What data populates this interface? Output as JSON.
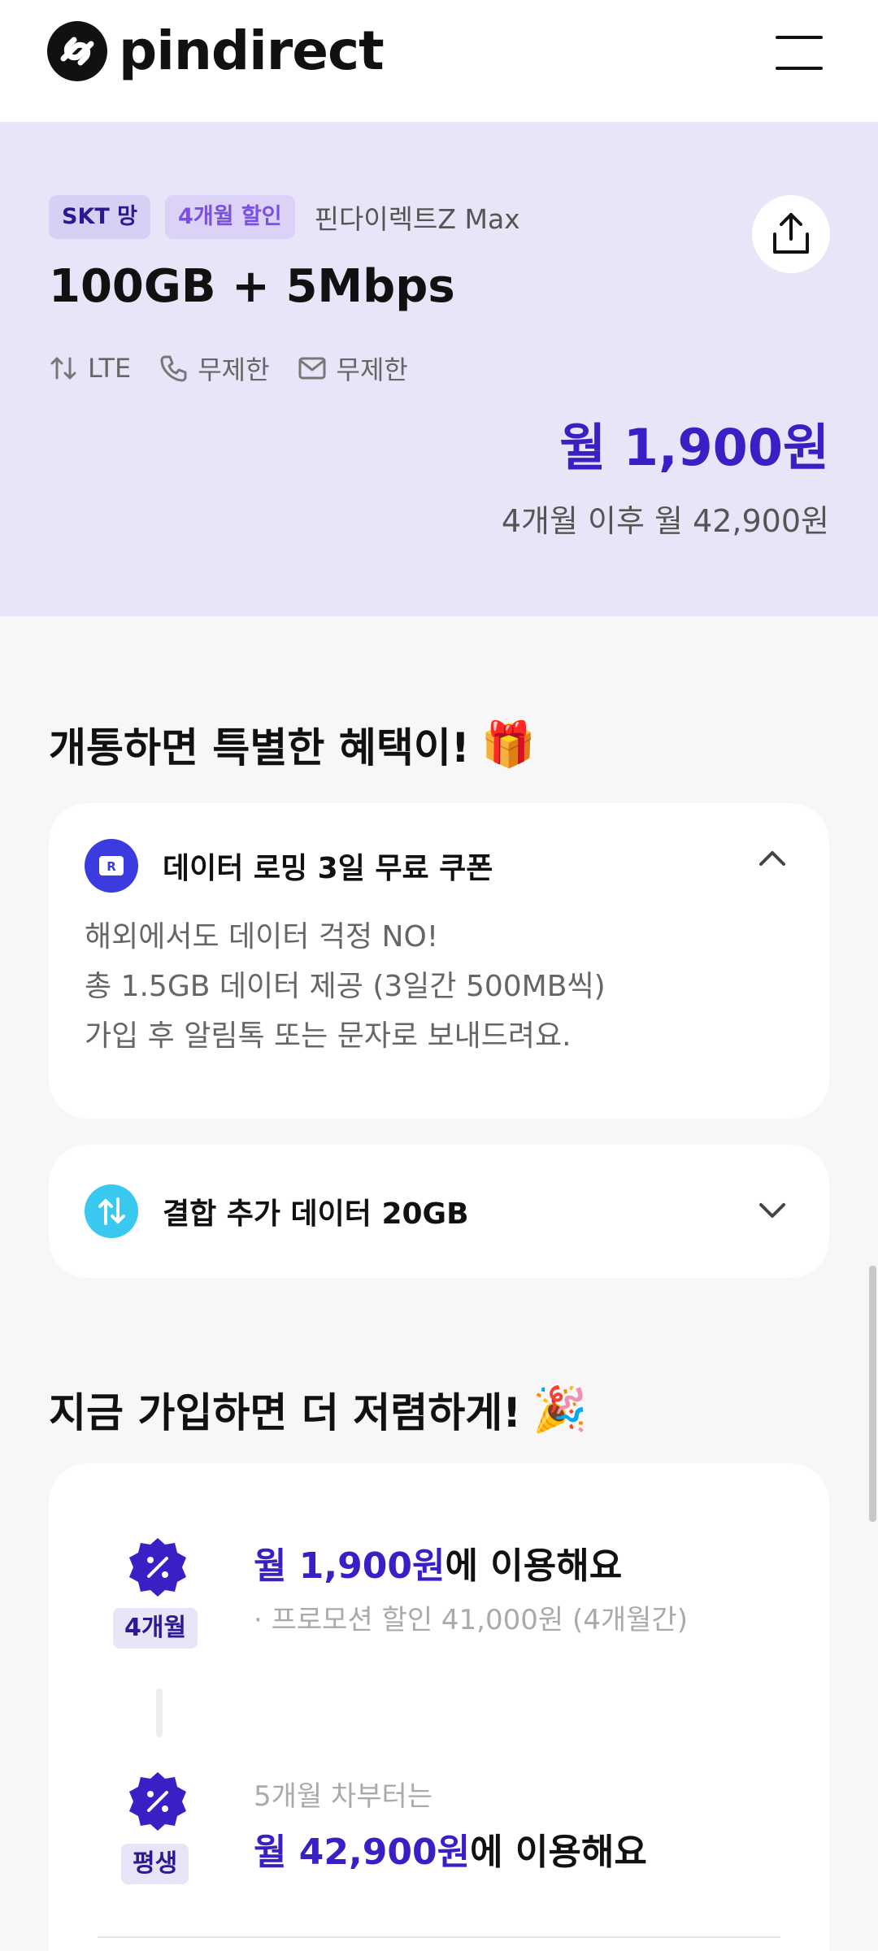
{
  "header": {
    "logo_text": "pindirect",
    "menu_icon": "hamburger-menu-icon"
  },
  "plan": {
    "network_badge": "SKT 망",
    "promo_badge": "4개월 할인",
    "carrier_name": "핀다이렉트Z Max",
    "title": "100GB + 5Mbps",
    "specs": {
      "network": "LTE",
      "calls": "무제한",
      "messages": "무제한"
    },
    "price": "월 1,900원",
    "price_after": "4개월 이후 월 42,900원",
    "share_icon": "share-icon"
  },
  "benefits_section": {
    "title": "개통하면 특별한 혜택이!",
    "title_emoji": "🎁",
    "roaming": {
      "label": "데이터 로밍 3일 무료 쿠폰",
      "lines": [
        "해외에서도 데이터 걱정 NO!",
        "총 1.5GB 데이터 제공 (3일간 500MB씩)",
        "가입 후 알림톡 또는 문자로 보내드려요."
      ]
    },
    "combo": {
      "label": "결합 추가 데이터 20GB"
    }
  },
  "discount_section": {
    "title": "지금 가입하면 더 저렴하게!",
    "title_emoji": "🎉",
    "rows": [
      {
        "tag": "4개월",
        "price": "월 1,900원",
        "suffix": "에 이용해요",
        "note": "· 프로모션 할인 41,000원 (4개월간)"
      },
      {
        "tag": "평생",
        "pre": "5개월 차부터는",
        "price": "월 42,900원",
        "suffix": "에 이용해요"
      }
    ]
  },
  "colors": {
    "accent": "#3c1fc4",
    "plan_bg": "#e8e5f8",
    "roaming_icon": "#3b3be0",
    "combo_icon": "#38c8f0"
  }
}
